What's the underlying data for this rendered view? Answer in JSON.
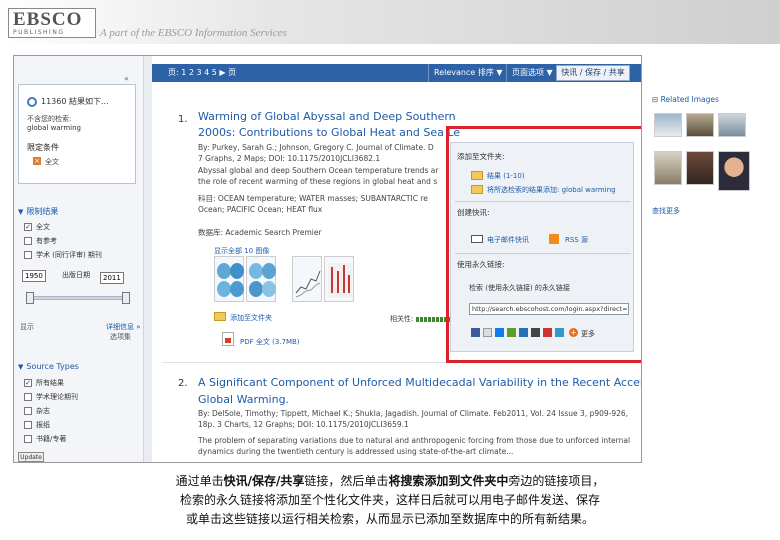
{
  "banner": {
    "logo_main": "EBSCO",
    "logo_sub": "PUBLISHING",
    "tagline": "A part of the EBSCO Information Services"
  },
  "left_panel": {
    "search": {
      "title": "11360 結果如下...",
      "label": "不含您的检索:",
      "query": "global warming",
      "limit_label": "限定条件",
      "limit_item": "全文"
    },
    "refine_title": "限制结果",
    "checks": [
      {
        "label": "全文",
        "checked": true
      },
      {
        "label": "有参考",
        "checked": false
      },
      {
        "label": "学术 (同行评审) 期刊",
        "checked": false
      }
    ],
    "year_from": "1950",
    "year_to": "2011",
    "year_label": "出版日期",
    "show_more_label": "显示",
    "options_label": "选项集",
    "more_link": "详细信息 »",
    "source_title": "Source Types",
    "sources": [
      "所有结果",
      "学术理论期刊",
      "杂志",
      "报纸",
      "书籍/专著"
    ],
    "update_btn": "Update"
  },
  "toolbar": {
    "pages": "页: 1 2 3 4 5  ▶  页",
    "sort": "Relevance 排序 ▼",
    "options": "页面选项 ▼",
    "share": "快讯 / 保存 / 共享"
  },
  "results": [
    {
      "num": "1.",
      "title_line1": "Warming of Global Abyssal and Deep Southern",
      "title_line2": "2000s: Contributions to Global Heat and Sea Le",
      "meta1": "By: Purkey, Sarah G.; Johnson, Gregory C. Journal of Climate. D",
      "meta2": "7 Graphs, 2 Maps; DOI: 10.1175/2010JCLI3682.1",
      "meta3": "Abyssal global and deep Southern Ocean temperature trends ar",
      "meta4": "the role of recent warming of these regions in global heat and s",
      "meta5": "科目: OCEAN temperature; WATER masses; SUBANTARCTIC re",
      "meta6": "Ocean; PACIFIC Ocean; HEAT flux",
      "meta7": "数据库: Academic Search Premier",
      "images_link": "显示全部 10 图像",
      "add_folder": "添加至文件夹",
      "relevance_label": "相关性:",
      "pdf_link": "PDF 全文 (3.7MB)"
    },
    {
      "num": "2.",
      "title_line1": "A Significant Component of Unforced Multidecadal Variability in the Recent Acceleration of",
      "title_line2": "Global Warming.",
      "meta1": "By: DelSole, Timothy; Tippett, Michael K.; Shukla, Jagadish. Journal of Climate. Feb2011, Vol. 24 Issue 3, p909-926,",
      "meta2": "18p. 3 Charts, 12 Graphs; DOI: 10.1175/2010JCLI3659.1",
      "meta3": "The problem of separating variations due to natural and anthropogenic forcing from those due to unforced internal",
      "meta4": "dynamics during the twentieth century is addressed using state-of-the-art climate..."
    }
  ],
  "share_panel": {
    "add_head": "添加至文件夹:",
    "folder_item": "结果 (1-10)",
    "folder_item2": "将所选检索的结果添加: global warming",
    "alert_head": "创建快讯:",
    "email_alert": "电子邮件快讯",
    "rss": "RSS 源",
    "link_head": "使用永久链接:",
    "link_label": "检索 (使用永久链接) 的永久链接",
    "url": "http://search.ebscohost.com/login.aspx?direct=t",
    "more_label": "更多"
  },
  "right_panel": {
    "head": "Related Images",
    "more": "查找更多"
  },
  "caption": {
    "line1_a": "通过单击",
    "line1_b": "快讯/保存/共享",
    "line1_c": "链接，然后单击",
    "line1_d": "将搜索添加到文件夹中",
    "line1_e": "旁边的链接项目，",
    "line2": "检索的永久链接将添加至个性化文件夹，这样日后就可以用电子邮件发送、保存",
    "line3": "或单击这些链接以运行相关检索，从而显示已添加至数据库中的所有新结果。"
  },
  "colors": {
    "accent": "#2d62a6",
    "link": "#1e5aa8",
    "highlight": "#d8232a"
  }
}
